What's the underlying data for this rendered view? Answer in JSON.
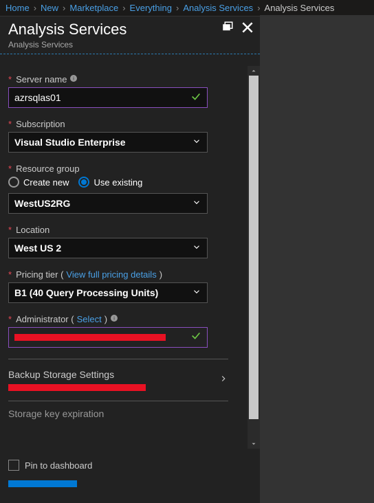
{
  "breadcrumb": {
    "items": [
      "Home",
      "New",
      "Marketplace",
      "Everything",
      "Analysis Services"
    ],
    "current": "Analysis Services"
  },
  "panel": {
    "title": "Analysis Services",
    "subtitle": "Analysis Services"
  },
  "form": {
    "server_name": {
      "label": "Server name",
      "value": "azrsqlas01"
    },
    "subscription": {
      "label": "Subscription",
      "value": "Visual Studio Enterprise"
    },
    "resource_group": {
      "label": "Resource group",
      "create_label": "Create new",
      "use_label": "Use existing",
      "selected": "use_existing",
      "value": "WestUS2RG"
    },
    "location": {
      "label": "Location",
      "value": "West US 2"
    },
    "pricing": {
      "label_prefix": "Pricing tier (",
      "link": "View full pricing details",
      "label_suffix": ")",
      "value": "B1 (40 Query Processing Units)"
    },
    "administrator": {
      "label_prefix": "Administrator (",
      "link": "Select",
      "label_suffix": ")"
    },
    "backup": {
      "title": "Backup Storage Settings"
    },
    "storage_key": {
      "label": "Storage key expiration"
    }
  },
  "footer": {
    "pin_label": "Pin to dashboard"
  }
}
